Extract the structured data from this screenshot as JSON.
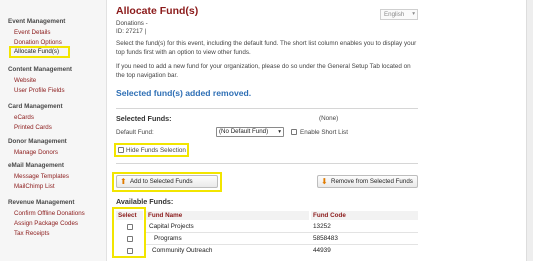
{
  "sidebar": {
    "sections": [
      {
        "title": "Event Management",
        "items": [
          "Event Details",
          "Donation Options",
          "Allocate Fund(s)"
        ]
      },
      {
        "title": "Content Management",
        "items": [
          "Website",
          "User Profile Fields"
        ]
      },
      {
        "title": "Card Management",
        "items": [
          "eCards",
          "Printed Cards"
        ]
      },
      {
        "title": "Donor Management",
        "items": [
          "Manage Donors"
        ]
      },
      {
        "title": "eMail Management",
        "items": [
          "Message Templates",
          "MailChimp List"
        ]
      },
      {
        "title": "Revenue Management",
        "items": [
          "Confirm Offline Donations",
          "Assign Package Codes",
          "Tax Receipts"
        ]
      }
    ]
  },
  "header": {
    "title": "Allocate Fund(s)",
    "subtitle": "Donations -",
    "id_line": "ID: 27217 |",
    "language": "English"
  },
  "instructions": {
    "p1": "Select the fund(s) for this event, including the default fund. The short list column enables you to display your top funds first with an option to view other funds.",
    "p2": "If you need to add a new fund for your organization, please do so under the General Setup Tab located on the top navigation bar."
  },
  "status_message": "Selected fund(s) added removed.",
  "selected_funds": {
    "heading": "Selected Funds:",
    "none_label": "(None)",
    "default_fund_label": "Default Fund:",
    "default_fund_value": "(No Default Fund)",
    "short_list_label": "Enable Short List",
    "hide_funds_label": "Hide Funds Selection"
  },
  "buttons": {
    "add": "Add to Selected Funds",
    "remove": "Remove from Selected Funds"
  },
  "available_funds": {
    "heading": "Available Funds:",
    "columns": [
      "Select",
      "Fund Name",
      "Fund Code"
    ],
    "rows": [
      {
        "name": "Capital Projects",
        "code": "13252"
      },
      {
        "name": "Programs",
        "code": "5858483"
      },
      {
        "name": "Community Outreach",
        "code": "44939"
      }
    ]
  }
}
